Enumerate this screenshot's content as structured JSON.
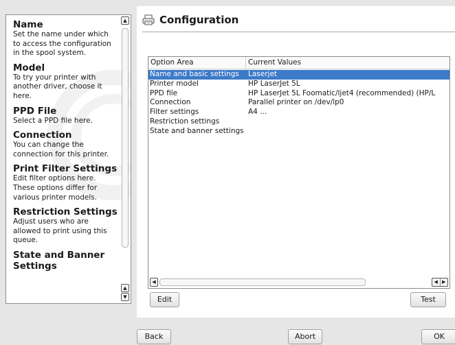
{
  "help": {
    "sections": [
      {
        "heading": "Name",
        "text": "Set the name under which to access the configuration in the spool system."
      },
      {
        "heading": "Model",
        "text": "To try your printer with another driver, choose it here."
      },
      {
        "heading": "PPD File",
        "text": "Select a PPD file here."
      },
      {
        "heading": "Connection",
        "text": "You can change the connection for this printer."
      },
      {
        "heading": "Print Filter Settings",
        "text": "Edit filter options here. These options differ for various printer models."
      },
      {
        "heading": "Restriction Settings",
        "text": "Adjust users who are allowed to print using this queue."
      },
      {
        "heading": "State and Banner Settings",
        "text": ""
      }
    ],
    "scroll_up_icon": "arrow-up",
    "scroll_down_icon": "arrow-down"
  },
  "main": {
    "title": "Configuration",
    "title_icon": "printer-icon",
    "table": {
      "columns": [
        "Option Area",
        "Current Values"
      ],
      "rows": [
        {
          "area": "Name and basic settings",
          "value": "Laserjet",
          "selected": true
        },
        {
          "area": "Printer model",
          "value": "HP  LaserJet 5L",
          "selected": false
        },
        {
          "area": "PPD file",
          "value": "HP LaserJet 5L Foomatic/ljet4 (recommended) (HP/L",
          "selected": false
        },
        {
          "area": "Connection",
          "value": "Parallel printer on /dev/lp0",
          "selected": false
        },
        {
          "area": "Filter settings",
          "value": "A4 ...",
          "selected": false
        },
        {
          "area": "Restriction settings",
          "value": "",
          "selected": false
        },
        {
          "area": "State and banner settings",
          "value": "",
          "selected": false
        }
      ],
      "selection_color": "#3d7ac8"
    },
    "edit_label": "Edit",
    "test_label": "Test"
  },
  "footer": {
    "back_label": "Back",
    "abort_label": "Abort",
    "ok_label": "OK"
  }
}
